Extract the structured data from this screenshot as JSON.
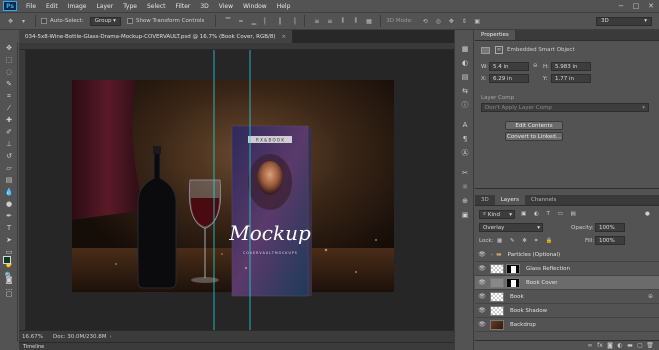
{
  "app": {
    "logo": "Ps"
  },
  "menu": [
    "File",
    "Edit",
    "Image",
    "Layer",
    "Type",
    "Select",
    "Filter",
    "3D",
    "View",
    "Window",
    "Help"
  ],
  "window_controls": {
    "minimize": "−",
    "maximize": "□",
    "close": "✕"
  },
  "options": {
    "move_icon": "✥",
    "auto_select_label": "Auto-Select:",
    "auto_select_value": "Group",
    "transform_label": "Show Transform Controls",
    "mode_3d_label": "3D Mode:",
    "workspace_value": "3D"
  },
  "document": {
    "tab_title": "034-5x8-Wine-Bottle-Glass-Drama-Mockup-COVERVAULT.psd @ 16.7% (Book Cover, RGB/8)",
    "tab_close": "×",
    "zoom": "16.67%",
    "doc_info": "Doc: 30.0M/230.8M",
    "cover_small_text": "R X & B O O K",
    "cover_title": "Mockup",
    "cover_subtitle": "C O V E R V A U L T   M O C K U P S"
  },
  "timeline_label": "Timeline",
  "properties": {
    "tab_label": "Properties",
    "object_type": "Embedded Smart Object",
    "w_label": "W:",
    "w_value": "5.4 in",
    "h_label": "H:",
    "h_value": "5.983 in",
    "x_label": "X:",
    "x_value": "6.29 in",
    "y_label": "Y:",
    "y_value": "1.77 in",
    "layer_comp_label": "Layer Comp",
    "layer_comp_placeholder": "Don't Apply Layer Comp",
    "edit_contents": "Edit Contents",
    "convert_linked": "Convert to Linked..."
  },
  "layers_panel": {
    "tabs": [
      "3D",
      "Layers",
      "Channels"
    ],
    "kind_label": "Kind",
    "blend_mode": "Overlay",
    "opacity_label": "Opacity:",
    "opacity_value": "100%",
    "lock_label": "Lock:",
    "fill_label": "Fill:",
    "fill_value": "100%",
    "layers": [
      {
        "name": "Particles (Optional)",
        "kind": "group"
      },
      {
        "name": "Glass Reflection",
        "kind": "mask"
      },
      {
        "name": "Book Cover",
        "kind": "smart",
        "selected": true
      },
      {
        "name": "Book",
        "kind": "smart"
      },
      {
        "name": "Book Shadow",
        "kind": "pixel"
      },
      {
        "name": "Backdrop",
        "kind": "image"
      }
    ],
    "footer_icons": [
      "link-icon",
      "fx-icon",
      "mask-icon",
      "adjustment-icon",
      "folder-icon",
      "new-layer-icon",
      "trash-icon"
    ]
  },
  "colors": {
    "accent_guide": "#2ad4d8",
    "foreground": "#0e3b1d",
    "background": "#ffffff"
  }
}
